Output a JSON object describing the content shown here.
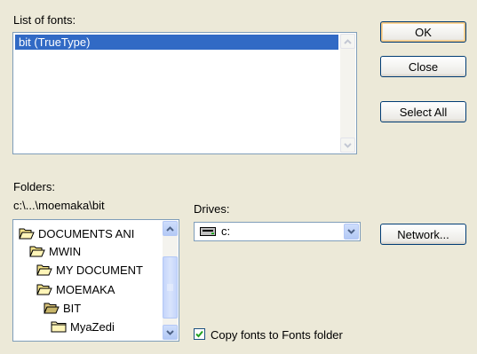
{
  "fonts_list": {
    "label": "List of fonts:",
    "items": [
      "bit (TrueType)"
    ]
  },
  "buttons": {
    "ok": "OK",
    "close": "Close",
    "select_all": "Select All",
    "network": "Network..."
  },
  "folders": {
    "label": "Folders:",
    "path": "c:\\...\\moemaka\\bit",
    "tree": [
      "DOCUMENTS ANI",
      "MWIN",
      "MY DOCUMENT",
      "MOEMAKA",
      "BIT",
      "MyaZedi"
    ]
  },
  "drives": {
    "label": "Drives:",
    "selected": "c:"
  },
  "copy_option": {
    "label": "Copy fonts to Fonts folder",
    "checked": true
  },
  "icons": {
    "folder_closed": "folder-icon",
    "folder_open": "folder-open-icon",
    "drive": "drive-icon"
  }
}
